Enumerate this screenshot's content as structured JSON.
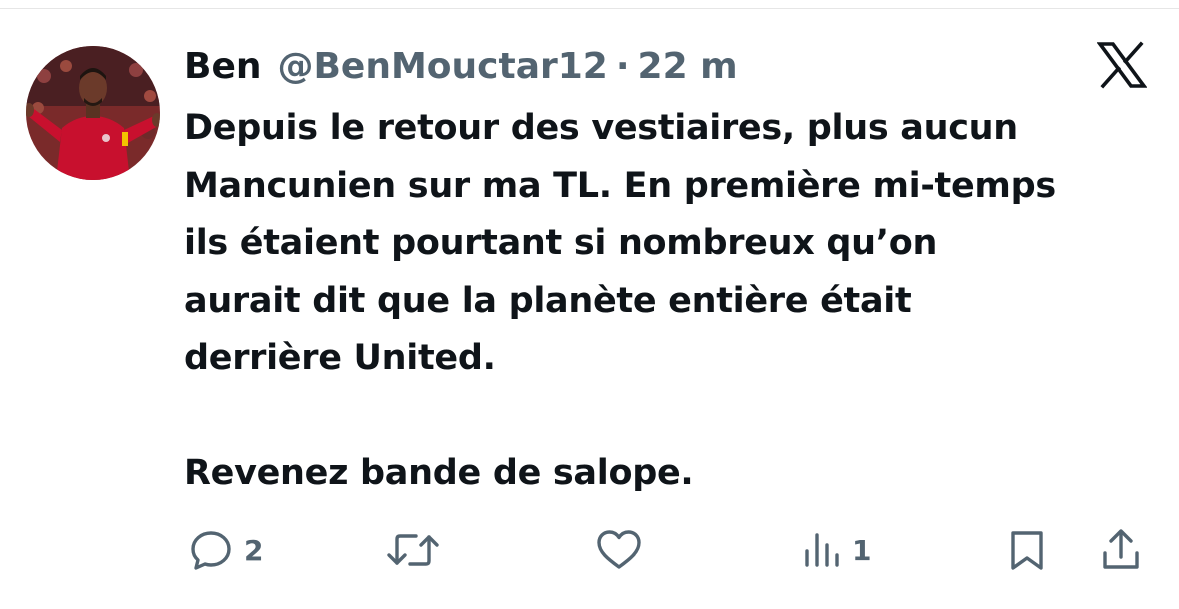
{
  "tweet": {
    "author_name": "Ben",
    "handle": "@BenMouctar12",
    "separator": "·",
    "time": "22 m",
    "lines": [
      "Depuis le retour des vestiaires, plus aucun",
      "Mancunien sur ma TL. En première mi-temps",
      "ils étaient pourtant si nombreux qu’on",
      "aurait dit que la planète entière était",
      "derrière United.",
      "Revenez bande de salope."
    ]
  },
  "actions": {
    "replies": "2",
    "views": "1"
  },
  "icons": [
    "x-logo-icon",
    "reply-icon",
    "retweet-icon",
    "like-icon",
    "views-icon",
    "bookmark-icon",
    "share-icon"
  ],
  "colors": {
    "text": "#0f1419",
    "secondary": "#536471",
    "jersey_red": "#c8102e"
  }
}
